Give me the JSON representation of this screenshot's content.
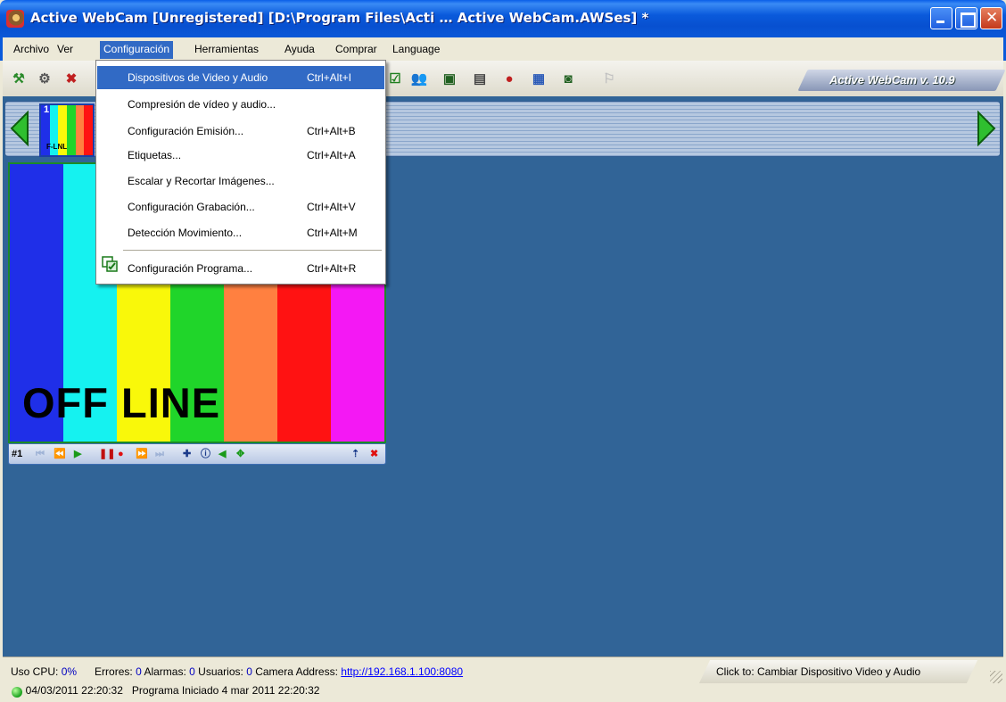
{
  "window": {
    "title": "Active WebCam [Unregistered] [D:\\Program Files\\Acti … Active WebCam.AWSes] *"
  },
  "menubar": {
    "items": [
      "Archivo",
      "Ver",
      "Configuración",
      "Herramientas",
      "Ayuda",
      "Comprar",
      "Language"
    ],
    "active": "Configuración"
  },
  "toolbar": {
    "version": "Active WebCam v. 10.9"
  },
  "dropdown": {
    "items": [
      {
        "label": "Dispositivos de Video y Audio",
        "shortcut": "Ctrl+Alt+I"
      },
      {
        "label": "Compresión de vídeo y audio...",
        "shortcut": ""
      },
      {
        "label": "Configuración Emisión...",
        "shortcut": "Ctrl+Alt+B"
      },
      {
        "label": "Etiquetas...",
        "shortcut": "Ctrl+Alt+A"
      },
      {
        "label": "Escalar y Recortar Imágenes...",
        "shortcut": ""
      },
      {
        "label": "Configuración Grabación...",
        "shortcut": "Ctrl+Alt+V"
      },
      {
        "label": "Detección Movimiento...",
        "shortcut": "Ctrl+Alt+M"
      },
      {
        "label": "Configuración Programa...",
        "shortcut": "Ctrl+Alt+R"
      }
    ],
    "highlighted_index": 0
  },
  "camera": {
    "thumb_number": "1",
    "thumb_caption": "F-LNL",
    "overlay_text": "OFF LINE",
    "control_label": "#1",
    "bar_colors": [
      "#1f2fe8",
      "#15f2f0",
      "#f9f80a",
      "#20d52a",
      "#ff8040",
      "#ff1212",
      "#f418f4"
    ]
  },
  "statusbar": {
    "cpu_label": "Uso CPU:",
    "cpu_value": "0%",
    "errors_label": "Errores:",
    "errors_value": "0",
    "alarms_label": "Alarmas:",
    "alarms_value": "0",
    "users_label": "Usuarios:",
    "users_value": "0",
    "address_label": "Camera Address:",
    "address_value": "http://192.168.1.100:8080",
    "hint": "Click to: Cambiar Dispositivo Video y Audio",
    "datetime": "04/03/2011 22:20:32",
    "message": "Programa Iniciado  4 mar 2011 22:20:32"
  }
}
